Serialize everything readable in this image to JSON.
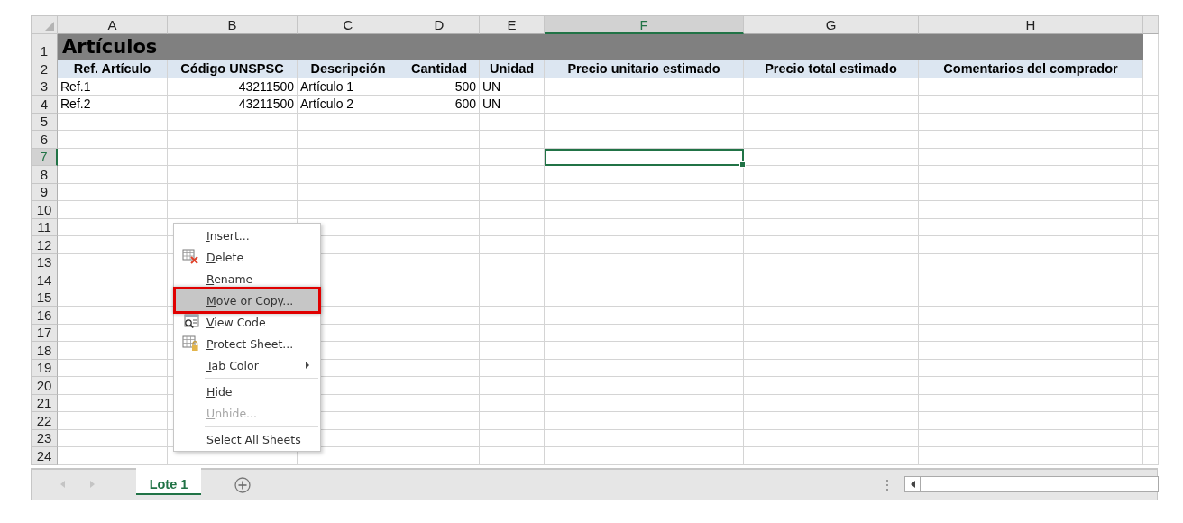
{
  "columns": [
    {
      "label": "A",
      "selected": false
    },
    {
      "label": "B",
      "selected": false
    },
    {
      "label": "C",
      "selected": false
    },
    {
      "label": "D",
      "selected": false
    },
    {
      "label": "E",
      "selected": false
    },
    {
      "label": "F",
      "selected": true
    },
    {
      "label": "G",
      "selected": false
    },
    {
      "label": "H",
      "selected": false
    }
  ],
  "rows": [
    {
      "label": "1",
      "selected": false
    },
    {
      "label": "2",
      "selected": false
    },
    {
      "label": "3",
      "selected": false
    },
    {
      "label": "4",
      "selected": false
    },
    {
      "label": "5",
      "selected": false
    },
    {
      "label": "6",
      "selected": false
    },
    {
      "label": "7",
      "selected": true
    },
    {
      "label": "8",
      "selected": false
    },
    {
      "label": "9",
      "selected": false
    },
    {
      "label": "10",
      "selected": false
    },
    {
      "label": "11",
      "selected": false
    },
    {
      "label": "12",
      "selected": false
    },
    {
      "label": "13",
      "selected": false
    },
    {
      "label": "14",
      "selected": false
    },
    {
      "label": "15",
      "selected": false
    },
    {
      "label": "16",
      "selected": false
    },
    {
      "label": "17",
      "selected": false
    },
    {
      "label": "18",
      "selected": false
    },
    {
      "label": "19",
      "selected": false
    },
    {
      "label": "20",
      "selected": false
    },
    {
      "label": "21",
      "selected": false
    },
    {
      "label": "22",
      "selected": false
    },
    {
      "label": "23",
      "selected": false
    },
    {
      "label": "24",
      "selected": false
    }
  ],
  "title": "Artículos",
  "headers": [
    "Ref. Artículo",
    "Código UNSPSC",
    "Descripción",
    "Cantidad",
    "Unidad",
    "Precio unitario estimado",
    "Precio total estimado",
    "Comentarios del comprador"
  ],
  "data_rows": [
    [
      "Ref.1",
      "43211500",
      "Artículo 1",
      "500",
      "UN"
    ],
    [
      "Ref.2",
      "43211500",
      "Artículo 2",
      "600",
      "UN"
    ]
  ],
  "context_menu": [
    {
      "kind": "item",
      "label": "Insert...",
      "selected": false,
      "disabled": false
    },
    {
      "kind": "item",
      "label": "Delete",
      "selected": false,
      "disabled": false
    },
    {
      "kind": "item",
      "label": "Rename",
      "selected": false,
      "disabled": false
    },
    {
      "kind": "item",
      "label": "Move or Copy...",
      "selected": true,
      "disabled": false
    },
    {
      "kind": "item",
      "label": "View Code",
      "selected": false,
      "disabled": false
    },
    {
      "kind": "item",
      "label": "Protect Sheet...",
      "selected": false,
      "disabled": false
    },
    {
      "kind": "item",
      "label": "Tab Color",
      "selected": false,
      "disabled": false,
      "submenu": true
    },
    {
      "kind": "separator"
    },
    {
      "kind": "item",
      "label": "Hide",
      "selected": false,
      "disabled": false
    },
    {
      "kind": "item",
      "label": "Unhide...",
      "selected": false,
      "disabled": true
    },
    {
      "kind": "separator"
    },
    {
      "kind": "item",
      "label": "Select All Sheets",
      "selected": false,
      "disabled": false
    }
  ],
  "sheet_tabs": [
    {
      "label": "Lote 1",
      "selected": true
    }
  ]
}
